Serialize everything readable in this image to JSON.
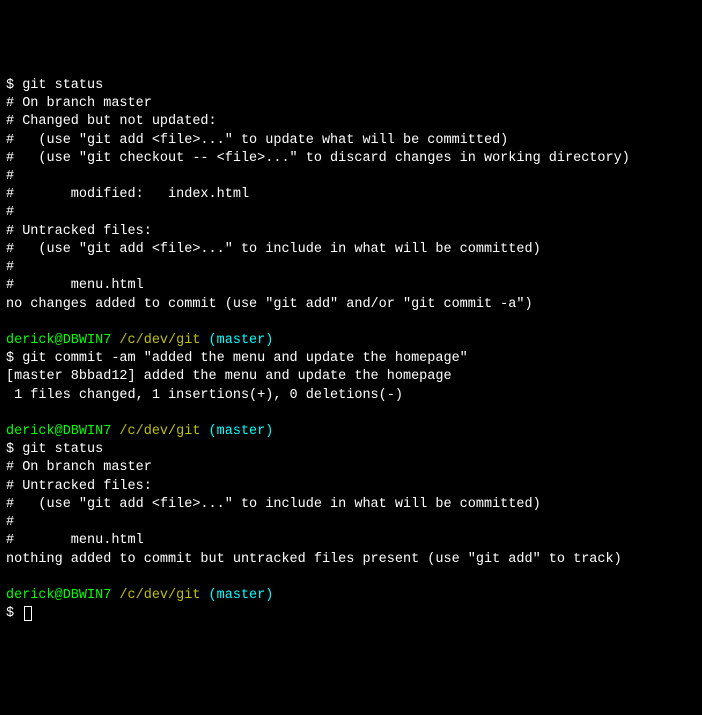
{
  "block1": {
    "cmd": "$ git status",
    "l1": "# On branch master",
    "l2": "# Changed but not updated:",
    "l3": "#   (use \"git add <file>...\" to update what will be committed)",
    "l4": "#   (use \"git checkout -- <file>...\" to discard changes in working directory)",
    "l5": "#",
    "l6": "#       modified:   index.html",
    "l7": "#",
    "l8": "# Untracked files:",
    "l9": "#   (use \"git add <file>...\" to include in what will be committed)",
    "l10": "#",
    "l11": "#       menu.html",
    "l12": "no changes added to commit (use \"git add\" and/or \"git commit -a\")"
  },
  "prompt1": {
    "user": "derick@DBWIN7",
    "path": " /c/dev/git",
    "branch": " (master)"
  },
  "block2": {
    "cmd": "$ git commit -am \"added the menu and update the homepage\"",
    "l1": "[master 8bbad12] added the menu and update the homepage",
    "l2": " 1 files changed, 1 insertions(+), 0 deletions(-)"
  },
  "prompt2": {
    "user": "derick@DBWIN7",
    "path": " /c/dev/git",
    "branch": " (master)"
  },
  "block3": {
    "cmd": "$ git status",
    "l1": "# On branch master",
    "l2": "# Untracked files:",
    "l3": "#   (use \"git add <file>...\" to include in what will be committed)",
    "l4": "#",
    "l5": "#       menu.html",
    "l6": "nothing added to commit but untracked files present (use \"git add\" to track)"
  },
  "prompt3": {
    "user": "derick@DBWIN7",
    "path": " /c/dev/git",
    "branch": " (master)"
  },
  "finalPrompt": "$ "
}
